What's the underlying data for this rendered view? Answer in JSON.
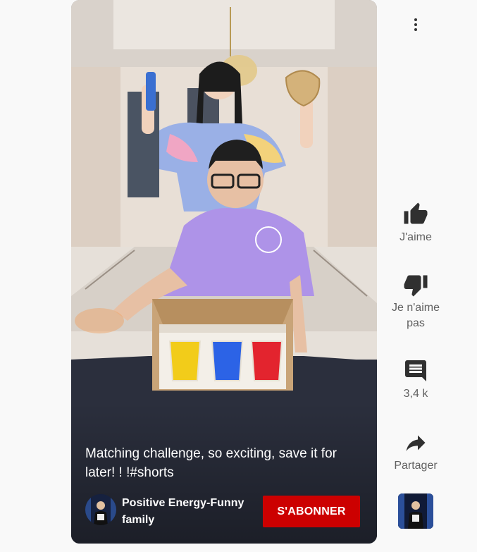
{
  "video": {
    "title": "Matching challenge, so exciting, save it for later! ! !#shorts"
  },
  "channel": {
    "name": "Positive Energy-Funny family",
    "subscribe_label": "S'ABONNER"
  },
  "actions": {
    "like_label": "J'aime",
    "dislike_label": "Je n'aime pas",
    "comments_count": "3,4 k",
    "share_label": "Partager"
  },
  "colors": {
    "subscribe_red": "#cc0000",
    "page_background": "#f9f9f9",
    "action_text": "#606060"
  },
  "icons": [
    "more-vert-icon",
    "thumb-up-icon",
    "thumb-down-icon",
    "comment-icon",
    "share-icon"
  ]
}
